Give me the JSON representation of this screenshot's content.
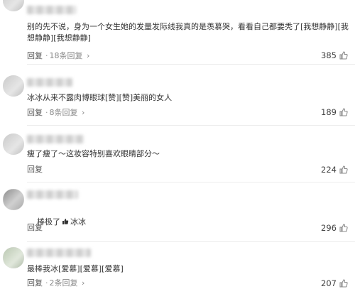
{
  "comments": [
    {
      "text": "别的先不说，身为一个女生她的发量发际线我真的是羡慕哭，看看自己都要秃了[我想静静][我想静静][我想静静]",
      "reply_label": "回复",
      "reply_count": "18条回复",
      "likes": "385"
    },
    {
      "text": "冰冰从来不露肉博眼球[赞][赞]美丽的女人",
      "reply_label": "回复",
      "reply_count": "8条回复",
      "likes": "189"
    },
    {
      "text": "瘦了瘦了～这妆容特别喜欢眼睛部分～",
      "reply_label": "回复",
      "reply_count": "",
      "likes": "224"
    },
    {
      "text_prefix": "棒极了",
      "text_suffix": "冰冰",
      "reply_label": "回复",
      "reply_count": "",
      "likes": "296"
    },
    {
      "text": "最棒我冰[爱慕][爱慕][爱慕]",
      "reply_label": "回复",
      "reply_count": "2条回复",
      "likes": "207"
    }
  ],
  "icons": {
    "like": "thumbs-up-icon",
    "chevron": "chevron-right-icon"
  }
}
